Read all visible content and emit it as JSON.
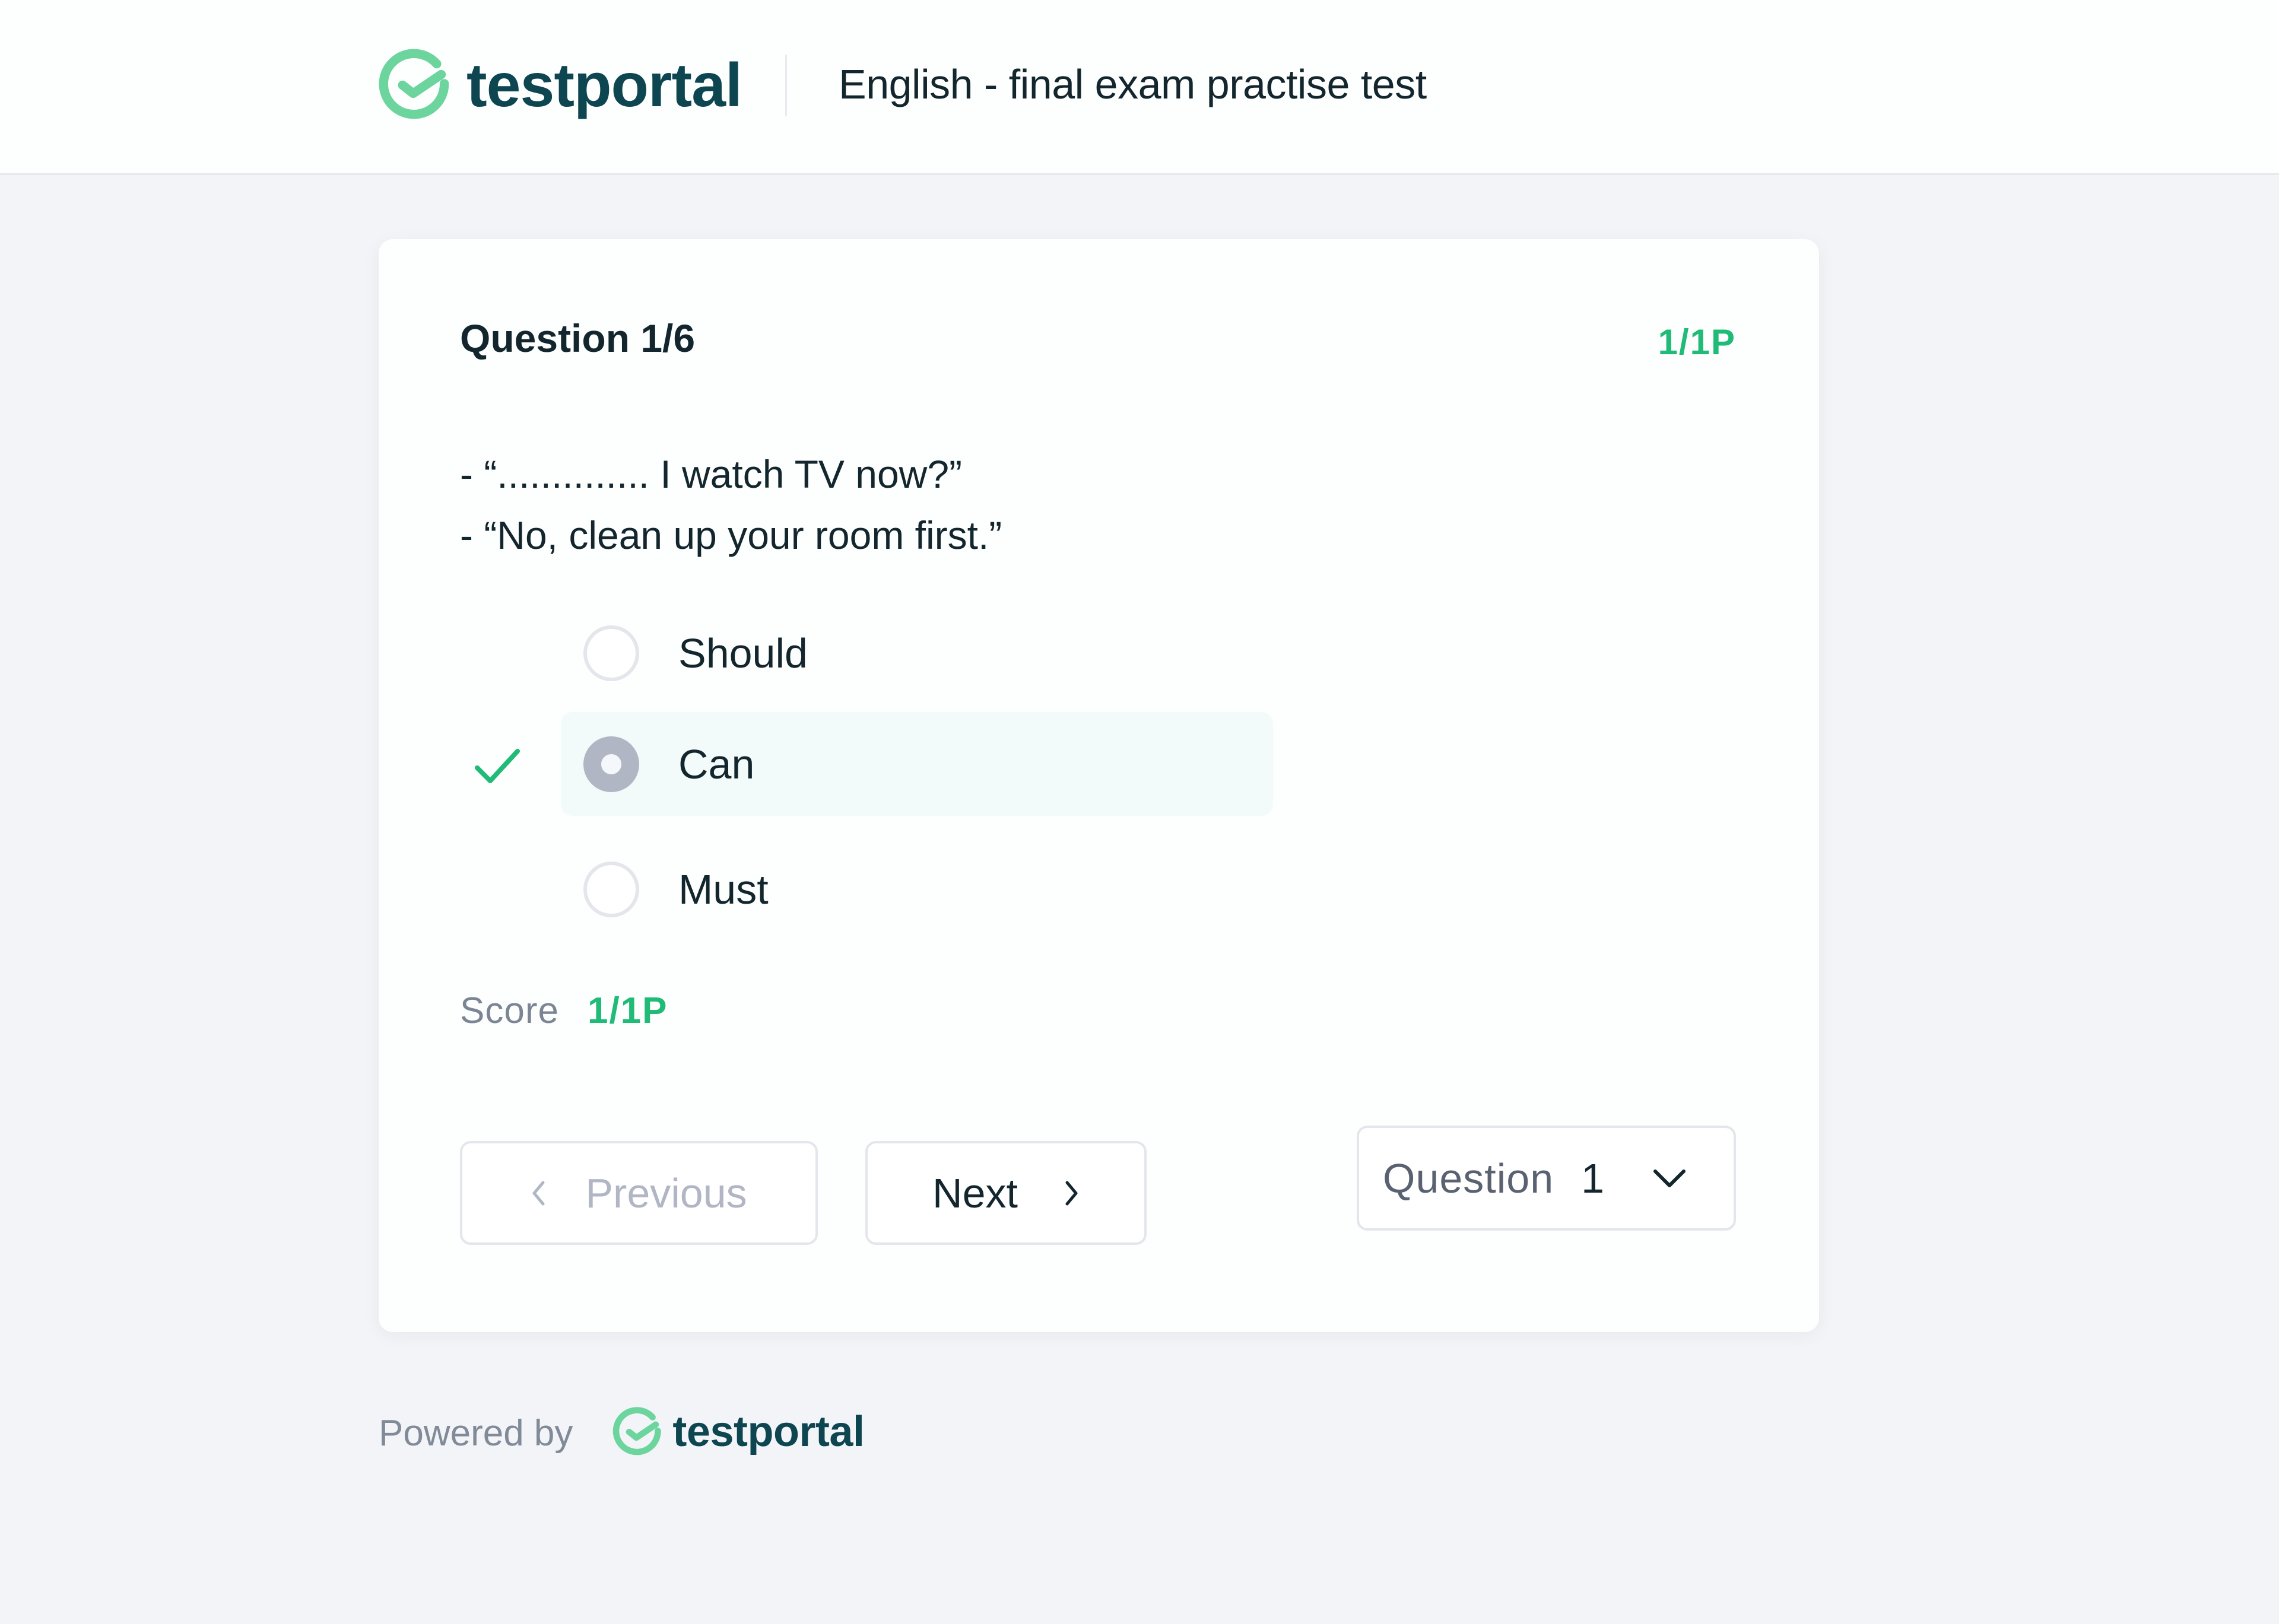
{
  "brand": {
    "name": "testportal",
    "colors": {
      "logo_green": "#6cd49d",
      "wordmark": "#0d4650",
      "accent_green": "#1fbb77",
      "text": "#13262d",
      "muted": "#7c8594",
      "selected_bg": "#f2fafa",
      "radio_selected": "#b1b6c4"
    }
  },
  "header": {
    "logo_icon": "check-circle-logo-icon",
    "test_title": "English - final exam practise test"
  },
  "question": {
    "heading": "Question 1/6",
    "points": "1/1P",
    "lines": [
      "- “.............. I watch TV now?”",
      "- “No, clean up your room first.”"
    ],
    "options": [
      {
        "label": "Should",
        "selected": false,
        "correct": false
      },
      {
        "label": "Can",
        "selected": true,
        "correct": true
      },
      {
        "label": "Must",
        "selected": false,
        "correct": false
      }
    ],
    "correct_icon": "checkmark-icon",
    "score_label": "Score",
    "score_value": "1/1P"
  },
  "navigation": {
    "previous_label": "Previous",
    "previous_enabled": false,
    "next_label": "Next",
    "question_select_label": "Question",
    "question_select_value": "1"
  },
  "footer": {
    "powered_by": "Powered by",
    "brand": "testportal"
  }
}
